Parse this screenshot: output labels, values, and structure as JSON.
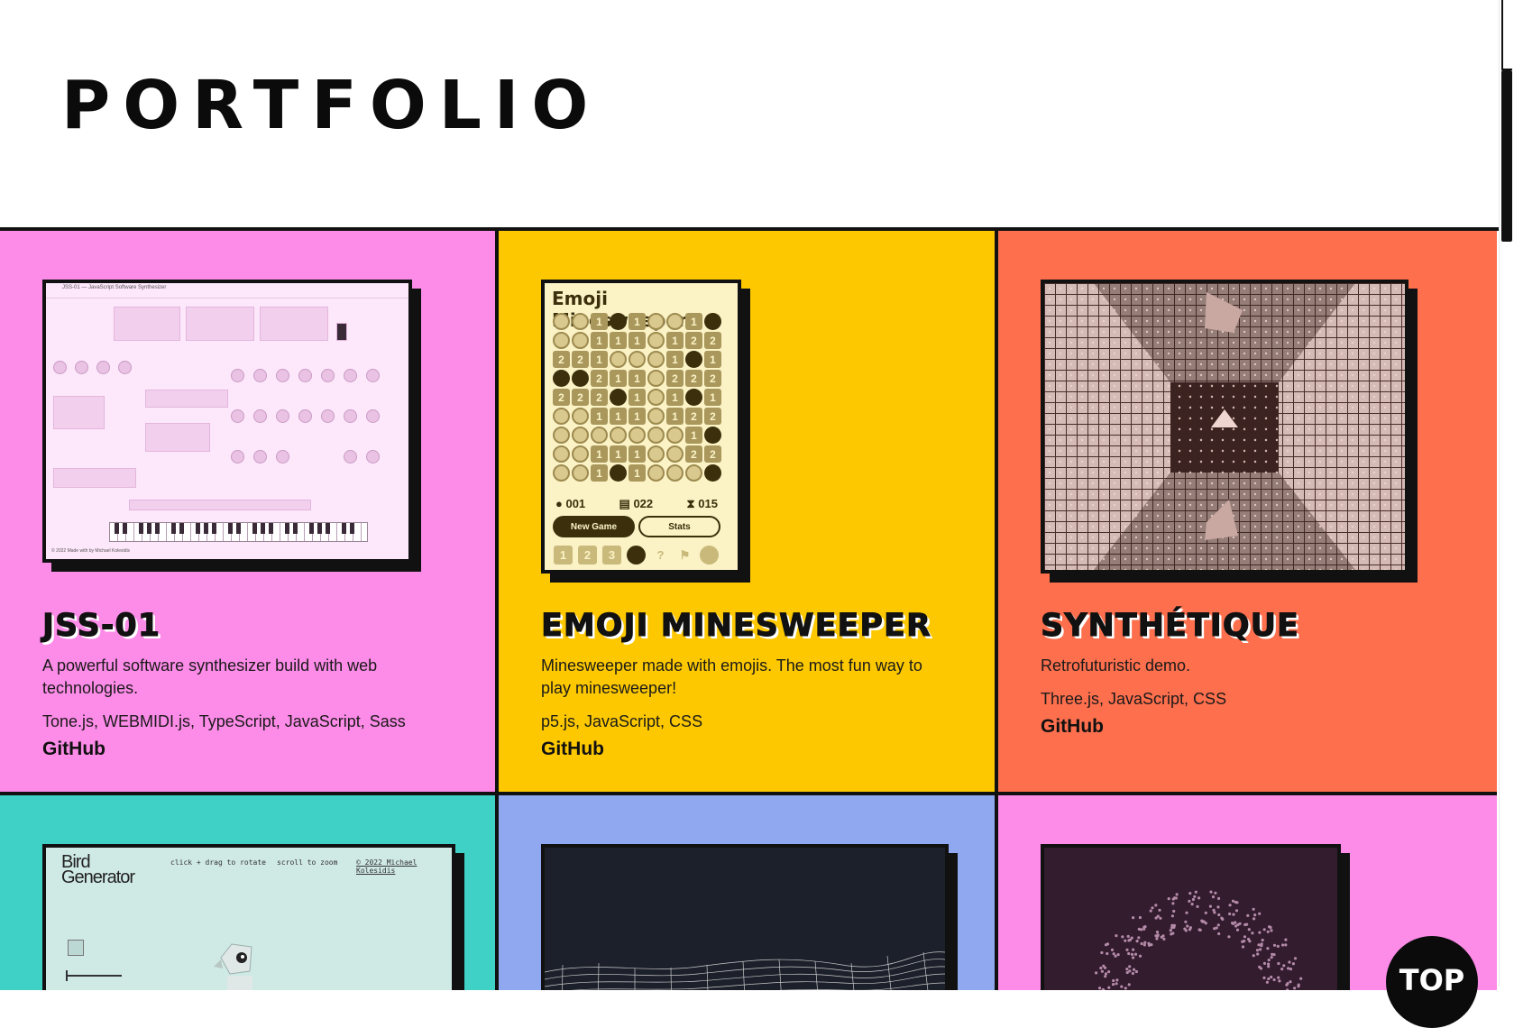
{
  "page": {
    "title": "PORTFOLIO"
  },
  "colors": {
    "pink": "#fd8be8",
    "yellow": "#fdc800",
    "orange": "#fe6f4d",
    "teal": "#3fd1c5",
    "periwinkle": "#8fa8ef",
    "border": "#111111"
  },
  "projects": [
    {
      "title": "JSS-01",
      "description": "A powerful software synthesizer build with web technologies.",
      "tech": "Tone.js, WEBMIDI.js, TypeScript, JavaScript, Sass",
      "link_label": "GitHub",
      "screenshot": {
        "header": "JSS-01 — JavaScript Software Synthesizer",
        "footer": "© 2022 Made with by Michael Kolesidis"
      }
    },
    {
      "title": "EMOJI MINESWEEPER",
      "description": "Minesweeper made with emojis. The most fun way to play minesweeper!",
      "tech": "p5.js, JavaScript, CSS",
      "link_label": "GitHub",
      "screenshot": {
        "game_title": "Emoji Minesweeper",
        "flags": "001",
        "moves": "022",
        "time": "015",
        "new_game_label": "New Game",
        "stats_label": "Stats",
        "board": [
          "S S 1 B 1 S S 1 B",
          "S S 1 1 1 S 1 2 2",
          "2 2 1 S S S 1 B 1",
          "B B 2 1 1 S 2 2 2",
          "2 2 2 B 1 S 1 B 1",
          "S S 1 1 1 S 1 2 2",
          "S S S S S S S 1 B",
          "S S 1 1 1 S S 2 2",
          "S S 1 B 1 S S S B"
        ],
        "toolbar_glyphs": [
          "1",
          "2",
          "3",
          "?"
        ]
      }
    },
    {
      "title": "SYNTHÉTIQUE",
      "description": "Retrofuturistic demo.",
      "tech": "Three.js, JavaScript, CSS",
      "link_label": "GitHub"
    },
    {
      "screenshot": {
        "logo_line1": "Bird",
        "logo_line2": "Generator",
        "hint_rotate": "click + drag to rotate",
        "hint_zoom": "scroll to zoom",
        "credit": "© 2022 Michael Kolesidis"
      }
    },
    {},
    {}
  ],
  "top_button_label": "TOP"
}
